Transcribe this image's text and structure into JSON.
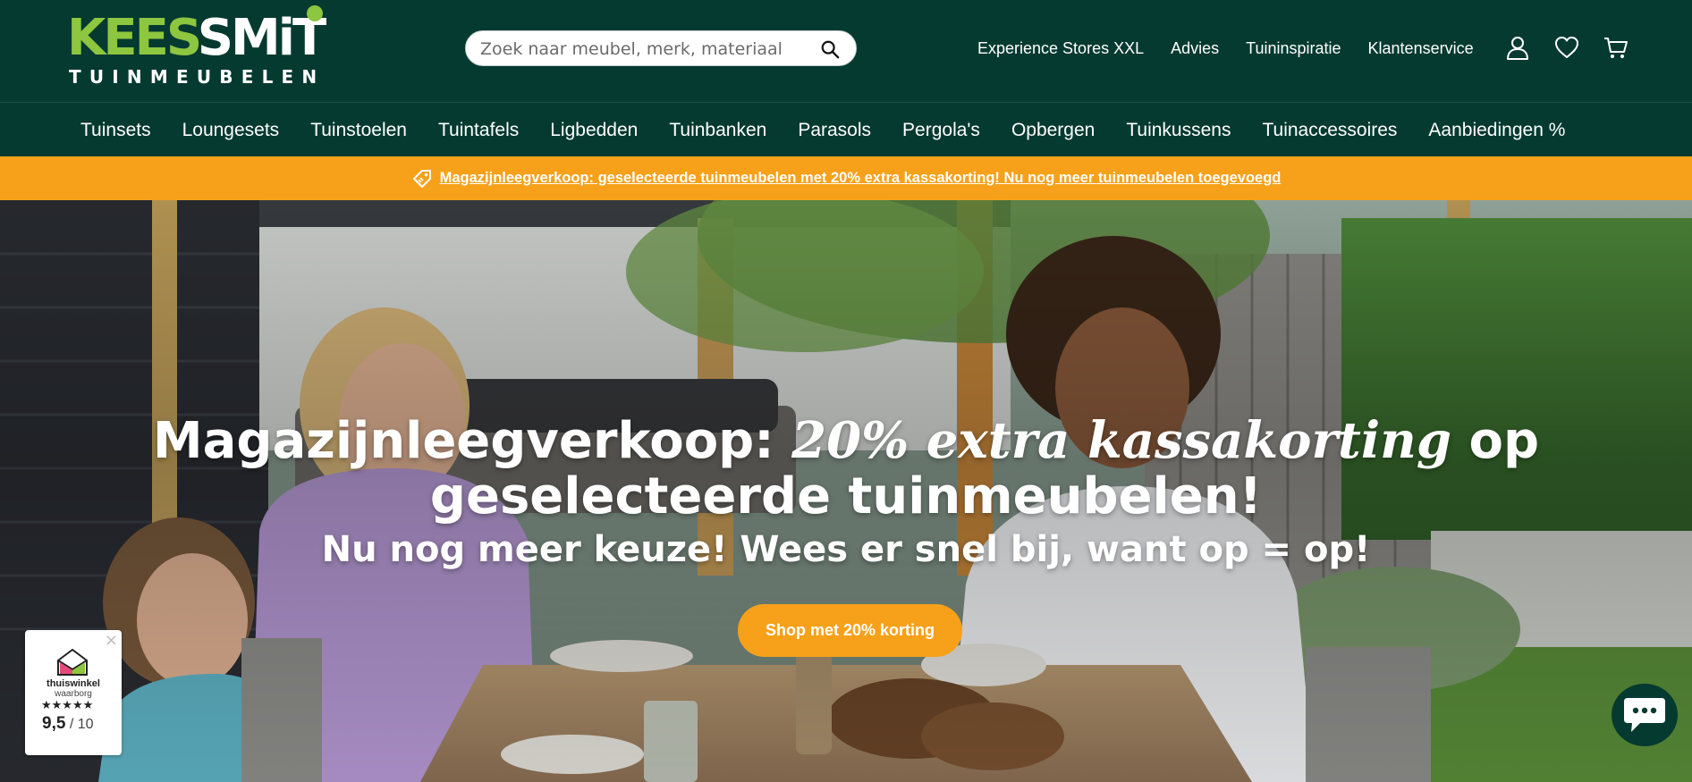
{
  "brand": {
    "logo_top_a": "KEES",
    "logo_top_b": "SMiT",
    "logo_bottom": "TUINMEUBELEN"
  },
  "search": {
    "placeholder": "Zoek naar meubel, merk, materiaal",
    "value": "",
    "icon": "search-icon"
  },
  "top_links": [
    "Experience Stores XXL",
    "Advies",
    "Tuininspiratie",
    "Klantenservice"
  ],
  "top_icons": [
    "account-icon",
    "heart-icon",
    "cart-icon"
  ],
  "nav": {
    "items": [
      "Tuinsets",
      "Loungesets",
      "Tuinstoelen",
      "Tuintafels",
      "Ligbedden",
      "Tuinbanken",
      "Parasols",
      "Pergola's",
      "Opbergen",
      "Tuinkussens",
      "Tuinaccessoires",
      "Aanbiedingen %"
    ]
  },
  "promo": {
    "icon": "tag-icon",
    "text": "Magazijnleegverkoop: geselecteerde tuinmeubelen met 20% extra kassakorting! Nu nog meer tuinmeubelen toegevoegd"
  },
  "hero": {
    "title_a": "Magazijnleegverkoop: ",
    "title_highlight": "20% extra kassakorting",
    "title_b": " op",
    "title_line2": "geselecteerde tuinmeubelen!",
    "subtitle": "Nu nog meer keuze! Wees er snel bij, want op = op!",
    "cta": "Shop met 20% korting"
  },
  "trust": {
    "name": "thuiswinkel",
    "sub": "waarborg",
    "stars": "★★★★★",
    "score": "9,5",
    "scale": " / 10",
    "close": "×"
  },
  "colors": {
    "header_bg": "#053a30",
    "logo_green": "#8dc63f",
    "accent_orange": "#f7a11a"
  }
}
